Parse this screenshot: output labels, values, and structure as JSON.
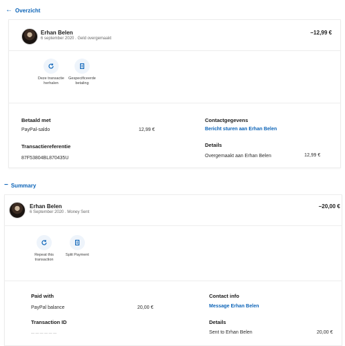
{
  "top": {
    "back_label": "Overzicht",
    "name": "Erhan Belen",
    "subtitle": "6 september 2020 . Geld overgemaakt",
    "amount": "−12,99 €",
    "actions": [
      {
        "icon": "refresh-icon",
        "label": "Deze transactie herhalen"
      },
      {
        "icon": "receipt-icon",
        "label": "Gespecificeerde betaling"
      }
    ],
    "paid_with": {
      "heading": "Betaald met",
      "method": "PayPal-saldo",
      "value": "12,99 €"
    },
    "reference": {
      "heading": "Transactiereferentie",
      "value": "87F53804BL870435U"
    },
    "contact": {
      "heading": "Contactgegevens",
      "link": "Bericht sturen aan Erhan Belen"
    },
    "details": {
      "heading": "Details",
      "label": "Overgemaakt aan Erhan Belen",
      "value": "12,99 €"
    }
  },
  "bottom": {
    "back_label": "Summary",
    "name": "Erhan Belen",
    "subtitle": "6 September 2020 . Money Sent",
    "amount": "−20,00 €",
    "actions": [
      {
        "icon": "refresh-icon",
        "label": "Repeat this transaction"
      },
      {
        "icon": "receipt-icon",
        "label": "Split Payment"
      }
    ],
    "paid_with": {
      "heading": "Paid with",
      "method": "PayPal balance",
      "value": "20,00 €"
    },
    "reference": {
      "heading": "Transaction ID",
      "value": "— — — — — —"
    },
    "contact": {
      "heading": "Contact info",
      "link": "Message Erhan Belen"
    },
    "details": {
      "heading": "Details",
      "label": "Sent to Erhan Belen",
      "value": "20,00 €"
    }
  },
  "colors": {
    "accent": "#0c64b8",
    "icon_bg": "#eef4fb"
  }
}
